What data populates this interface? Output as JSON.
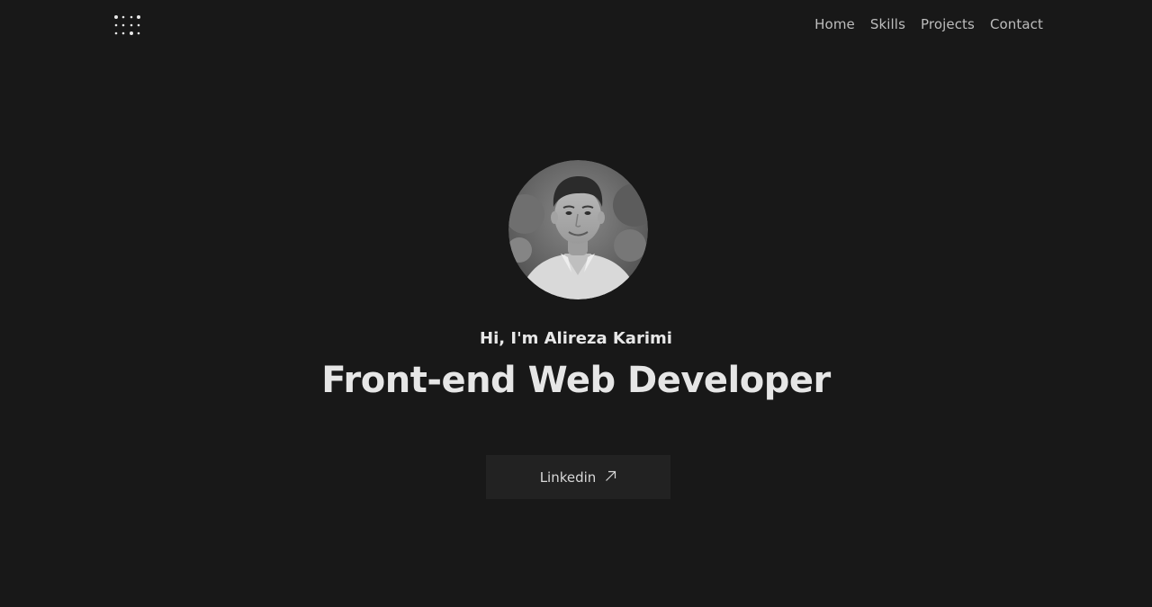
{
  "header": {
    "logo_icon": "dot-grid-logo-icon",
    "nav": [
      {
        "label": "Home"
      },
      {
        "label": "Skills"
      },
      {
        "label": "Projects"
      },
      {
        "label": "Contact"
      }
    ]
  },
  "hero": {
    "greeting": "Hi, I'm Alireza Karimi",
    "title": "Front-end Web Developer",
    "button": {
      "label": "Linkedin",
      "icon": "arrow-up-right-icon"
    }
  },
  "colors": {
    "background": "#181818",
    "button_background": "#222222",
    "text": "#e6e6e6",
    "nav_text": "#bdbdbd"
  }
}
